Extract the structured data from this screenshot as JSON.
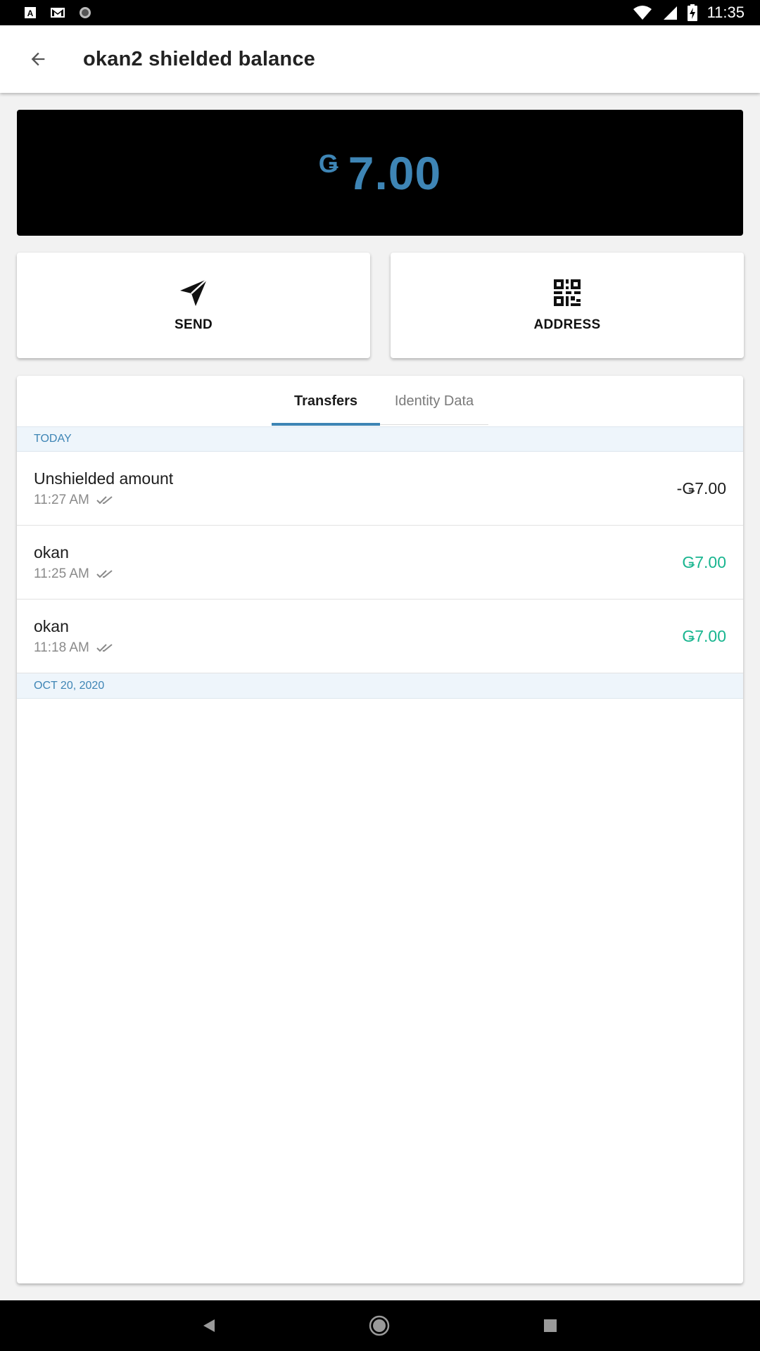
{
  "status_bar": {
    "time": "11:35",
    "left_icons": [
      "app-a-icon",
      "gmail-icon",
      "record-icon"
    ],
    "right_icons": [
      "wifi-icon",
      "signal-icon",
      "battery-charging-icon"
    ]
  },
  "app_bar": {
    "title": "okan2 shielded balance",
    "back_icon": "arrow-left-icon"
  },
  "balance": {
    "currency_symbol": "Ǥ",
    "amount": "7.00",
    "color": "#3e85b5"
  },
  "actions": {
    "send": {
      "label": "SEND",
      "icon": "send-icon"
    },
    "address": {
      "label": "ADDRESS",
      "icon": "qr-code-icon"
    }
  },
  "tabs": [
    {
      "label": "Transfers",
      "active": true
    },
    {
      "label": "Identity Data",
      "active": false
    }
  ],
  "sections": [
    {
      "header": "TODAY",
      "transactions": [
        {
          "name": "Unshielded amount",
          "time": "11:27 AM",
          "amount": "-Ǥ7.00",
          "type": "negative"
        },
        {
          "name": "okan",
          "time": "11:25 AM",
          "amount": "Ǥ7.00",
          "type": "positive"
        },
        {
          "name": "okan",
          "time": "11:18 AM",
          "amount": "Ǥ7.00",
          "type": "positive"
        }
      ]
    },
    {
      "header": "OCT 20, 2020",
      "transactions": []
    }
  ],
  "colors": {
    "accent": "#3e85b5",
    "positive": "#18b58f",
    "negative": "#1c1c1c"
  },
  "nav_bar": {
    "icons": [
      "nav-back-icon",
      "nav-home-icon",
      "nav-recent-icon"
    ]
  }
}
